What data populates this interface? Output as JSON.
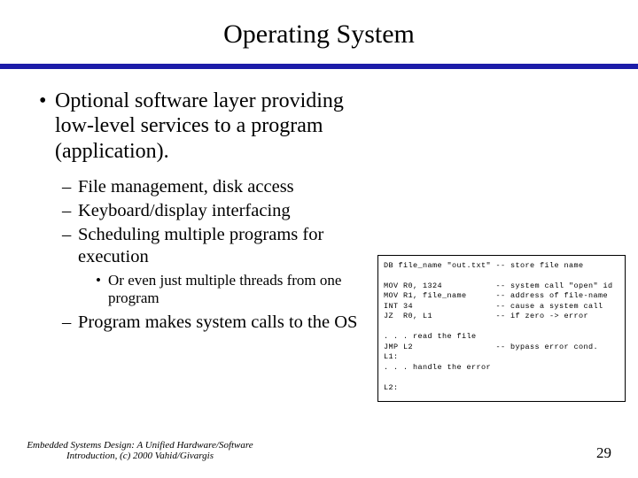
{
  "title": "Operating System",
  "bullets": {
    "lvl1": "Optional software layer providing low-level services to a program (application).",
    "lvl2": {
      "a": "File management, disk access",
      "b": "Keyboard/display interfacing",
      "c": "Scheduling multiple programs for execution",
      "d": "Program makes system calls to the OS"
    },
    "lvl3": "Or even just multiple threads from one program"
  },
  "code": "DB file_name \"out.txt\" -- store file name\n\nMOV R0, 1324           -- system call \"open\" id\nMOV R1, file_name      -- address of file-name\nINT 34                 -- cause a system call\nJZ  R0, L1             -- if zero -> error\n\n. . . read the file\nJMP L2                 -- bypass error cond.\nL1:\n. . . handle the error\n\nL2:",
  "footer": {
    "left": "Embedded Systems Design: A Unified Hardware/Software Introduction, (c) 2000 Vahid/Givargis",
    "page": "29"
  }
}
